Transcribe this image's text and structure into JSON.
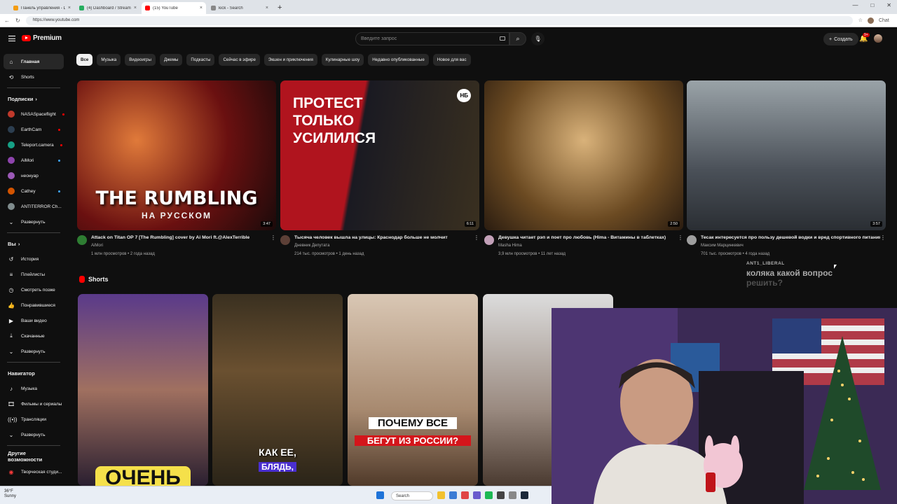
{
  "browser": {
    "tabs": [
      {
        "label": "Панель управления - Donationali",
        "color": "#f39c12"
      },
      {
        "label": "(4) Dashboard / Streamelas",
        "color": "#27ae60"
      },
      {
        "label": "(15) YouTube",
        "color": "#ff0000",
        "active": true
      },
      {
        "label": "kick - Search",
        "color": "#888888"
      }
    ],
    "url": "https://www.youtube.com",
    "ai_button": "Chat"
  },
  "masthead": {
    "logo": "Premium",
    "search_placeholder": "Введите запрос",
    "create_label": "Создать",
    "notifications": "9+"
  },
  "sidebar": {
    "main": [
      {
        "label": "Главная",
        "icon": "home-icon",
        "selected": true
      },
      {
        "label": "Shorts",
        "icon": "shorts-icon"
      }
    ],
    "subs_title": "Подписки",
    "subs": [
      {
        "label": "NASASpaceflight",
        "color": "#c0392b",
        "live": "#ff0000"
      },
      {
        "label": "EarthCam",
        "color": "#2c3e50",
        "live": "#ff0000"
      },
      {
        "label": "Teleport.camera",
        "color": "#16a085",
        "live": "#ff0000"
      },
      {
        "label": "AiMori",
        "color": "#8e44ad",
        "live": "#3ea6ff"
      },
      {
        "label": "неонyap",
        "color": "#9b59b6",
        "live": ""
      },
      {
        "label": "Cathey",
        "color": "#d35400",
        "live": "#3ea6ff"
      },
      {
        "label": "ANTITERROR Ch...",
        "color": "#7f8c8d",
        "live": "#3ea6ff"
      }
    ],
    "expand": "Развернуть",
    "you_title": "Вы",
    "you": [
      {
        "label": "История",
        "icon": "history-icon"
      },
      {
        "label": "Плейлисты",
        "icon": "playlists-icon"
      },
      {
        "label": "Смотреть позже",
        "icon": "watch-later-icon"
      },
      {
        "label": "Понравившиеся",
        "icon": "like-icon"
      },
      {
        "label": "Ваши видео",
        "icon": "your-videos-icon"
      },
      {
        "label": "Скачанные",
        "icon": "download-icon"
      },
      {
        "label": "Развернуть",
        "icon": "chevron-down-icon"
      }
    ],
    "nav_title": "Навигатор",
    "nav": [
      {
        "label": "Музыка",
        "icon": "music-icon"
      },
      {
        "label": "Фильмы и сериалы",
        "icon": "movies-icon"
      },
      {
        "label": "Трансляции",
        "icon": "live-icon"
      },
      {
        "label": "Развернуть",
        "icon": "chevron-down-icon"
      }
    ],
    "more_title": "Другие возможности",
    "more": [
      {
        "label": "Творческая студи...",
        "icon": "studio-icon"
      }
    ]
  },
  "chips": [
    "Все",
    "Музыка",
    "Видеоигры",
    "Джемы",
    "Подкасты",
    "Сейчас в эфире",
    "Экшен и приключения",
    "Кулинарные шоу",
    "Недавно опубликованные",
    "Новое для вас"
  ],
  "videos": [
    {
      "title": "Attack on Titan OP 7 [The Rumbling] cover by Ai Mori ft.@AlexTerrible",
      "channel": "AiMori",
      "meta": "1 млн просмотров • 2 года назад",
      "duration": "3:47",
      "thumb_text": "THE RUMBLING",
      "thumb_sub": "НА РУССКОМ",
      "avatar": "#2e7d32"
    },
    {
      "title": "Тысяча человек вышла на улицы: Краснодар больше не молчит",
      "channel": "Дневник Депутата",
      "meta": "214 тыс. просмотров • 1 день назад",
      "duration": "6:11",
      "thumb_text": "ПРОТЕСТ ТОЛЬКО УСИЛИЛСЯ",
      "thumb_sub": "НБ",
      "avatar": "#5d4037"
    },
    {
      "title": "Девушка читает рэп и поет про любовь (Hima - Витамины в таблетках)",
      "channel": "Masha Hima",
      "meta": "3,9 млн просмотров • 11 лет назад",
      "duration": "2:50",
      "thumb_text": "",
      "thumb_sub": "",
      "avatar": "#c2a0b8"
    },
    {
      "title": "Тесак интересуется про пользу дешевой водки и вред спортивного питания",
      "channel": "Максим Марцинкевич",
      "meta": "701 тыс. просмотров • 4 года назад",
      "duration": "3:57",
      "thumb_text": "",
      "thumb_sub": "",
      "avatar": "#9e9e9e"
    }
  ],
  "shorts": {
    "title": "Shorts",
    "items": [
      {
        "caption": "ОЧЕНЬ",
        "sub": ""
      },
      {
        "caption": "КАК ЕЕ,",
        "sub": "БЛЯДЬ,"
      },
      {
        "caption": "ПОЧЕМУ ВСЕ",
        "sub": "БЕГУТ ИЗ РОССИИ?"
      },
      {
        "caption": "",
        "sub": ""
      }
    ]
  },
  "chat": {
    "user": "ANT1_LIBERAL",
    "message": "коляка какой вопрос",
    "message_cont": "решить?"
  },
  "taskbar": {
    "weather_temp": "36°F",
    "weather_desc": "Sunny",
    "search": "Search"
  }
}
